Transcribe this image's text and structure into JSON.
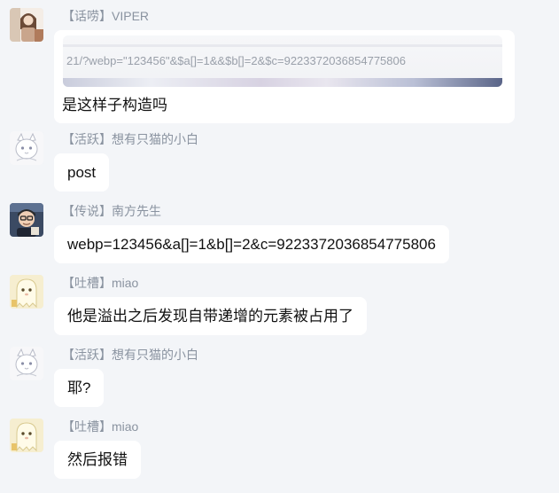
{
  "messages": [
    {
      "tag": "【话唠】",
      "name": "VIPER",
      "avatar_icon": "girl-portrait-avatar",
      "quote_url": "21/?webp=\"123456\"&$a[]=1&&$b[]=2&$c=9223372036854775806",
      "text": "是这样子构造吗"
    },
    {
      "tag": "【活跃】",
      "name": "想有只猫的小白",
      "avatar_icon": "white-cat-avatar",
      "text": "post"
    },
    {
      "tag": "【传说】",
      "name": "南方先生",
      "avatar_icon": "cartoon-boy-avatar",
      "text": "webp=123456&a[]=1&b[]=2&c=9223372036854775806"
    },
    {
      "tag": "【吐槽】",
      "name": "miao",
      "avatar_icon": "yellow-ghost-avatar",
      "text": "他是溢出之后发现自带递增的元素被占用了"
    },
    {
      "tag": "【活跃】",
      "name": "想有只猫的小白",
      "avatar_icon": "white-cat-avatar",
      "text": "耶?"
    },
    {
      "tag": "【吐槽】",
      "name": "miao",
      "avatar_icon": "yellow-ghost-avatar",
      "text": "然后报错"
    }
  ]
}
